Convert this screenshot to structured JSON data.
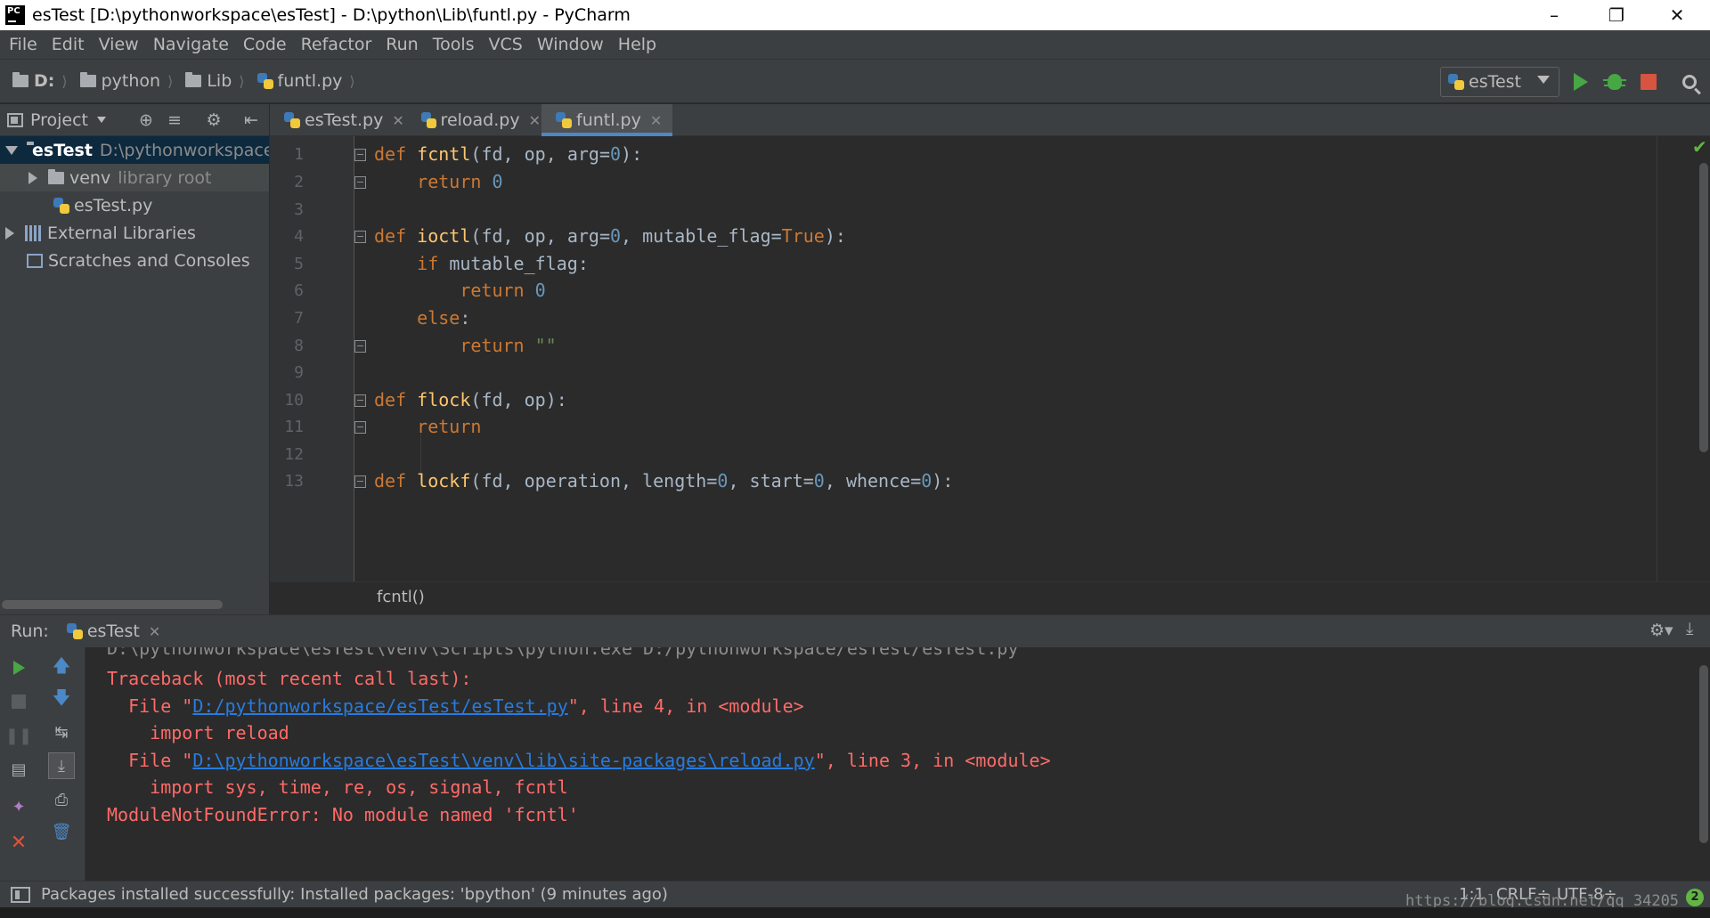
{
  "window": {
    "title": "esTest [D:\\pythonworkspace\\esTest] - D:\\python\\Lib\\funtl.py - PyCharm",
    "app_icon": "PC",
    "controls": [
      "minimize-icon",
      "restore-icon",
      "close-icon"
    ]
  },
  "menu": [
    "File",
    "Edit",
    "View",
    "Navigate",
    "Code",
    "Refactor",
    "Run",
    "Tools",
    "VCS",
    "Window",
    "Help"
  ],
  "navbar": {
    "breadcrumbs": [
      {
        "label": "D:",
        "icon": "folder-icon"
      },
      {
        "label": "python",
        "icon": "folder-icon"
      },
      {
        "label": "Lib",
        "icon": "folder-icon"
      },
      {
        "label": "funtl.py",
        "icon": "python-file-icon"
      }
    ],
    "run_config": "esTest"
  },
  "project": {
    "header_label": "Project",
    "tree": [
      {
        "name": "esTest",
        "hint": "D:\\pythonworkspace",
        "expanded": true
      },
      {
        "name": "venv",
        "hint": "library root",
        "expanded": false
      },
      {
        "name": "esTest.py",
        "hint": ""
      },
      {
        "name": "External Libraries",
        "hint": "",
        "expanded": false
      },
      {
        "name": "Scratches and Consoles",
        "hint": ""
      }
    ]
  },
  "tabs": [
    {
      "label": "esTest.py",
      "active": false
    },
    {
      "label": "reload.py",
      "active": false
    },
    {
      "label": "funtl.py",
      "active": true
    }
  ],
  "editor": {
    "line_numbers": [
      "1",
      "2",
      "3",
      "4",
      "5",
      "6",
      "7",
      "8",
      "9",
      "10",
      "11",
      "12",
      "13"
    ],
    "lines": [
      "def fcntl(fd, op, arg=0):",
      "    return 0",
      "",
      "def ioctl(fd, op, arg=0, mutable_flag=True):",
      "    if mutable_flag:",
      "        return 0",
      "    else:",
      "        return \"\"",
      "",
      "def flock(fd, op):",
      "    return",
      "",
      "def lockf(fd, operation, length=0, start=0, whence=0):"
    ],
    "breadcrumb": "fcntl()"
  },
  "run": {
    "label": "Run:",
    "tab": "esTest",
    "console": {
      "cut_line": "D:\\pythonworkspace\\esTest\\venv\\Scripts\\python.exe D:/pythonworkspace/esTest/esTest.py",
      "traceback": "Traceback (most recent call last):",
      "file1_prefix": "  File \"",
      "file1_link": "D:/pythonworkspace/esTest/esTest.py",
      "file1_suffix": "\", line 4, in <module>",
      "code1": "    import reload",
      "file2_prefix": "  File \"",
      "file2_link": "D:\\pythonworkspace\\esTest\\venv\\lib\\site-packages\\reload.py",
      "file2_suffix": "\", line 3, in <module>",
      "code2": "    import sys, time, re, os, signal, fcntl",
      "error": "ModuleNotFoundError: No module named 'fcntl'"
    }
  },
  "status": {
    "message": "Packages installed successfully: Installed packages: 'bpython' (9 minutes ago)",
    "position": "1:1",
    "line_sep": "CRLF÷",
    "encoding": "UTF-8÷",
    "watermark": "https://blog.csdn.net/qq_34205",
    "notifications": "2"
  },
  "colors": {
    "keyword": "#cc7832",
    "function": "#ffc66d",
    "number": "#6897bb",
    "string": "#6a8759",
    "error": "#ff6b68",
    "link": "#287bde",
    "run_green": "#46a744",
    "stop_red": "#d75440"
  }
}
